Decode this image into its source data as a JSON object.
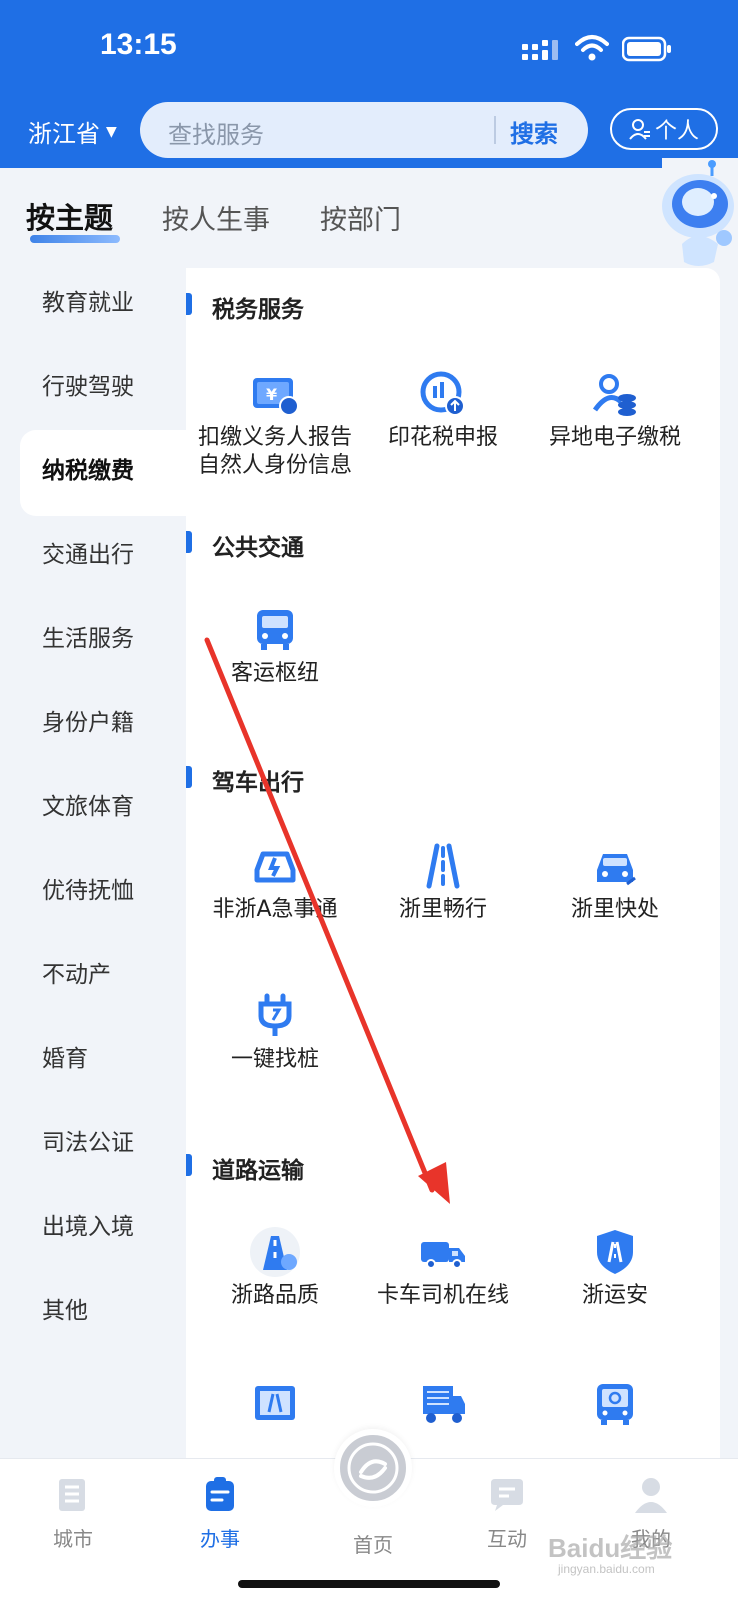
{
  "status": {
    "time": "13:15"
  },
  "header": {
    "province": "浙江省",
    "search_placeholder": "查找服务",
    "search_button": "搜索",
    "person_button": "个人"
  },
  "top_tabs": [
    "按主题",
    "按人生事",
    "按部门"
  ],
  "sidebar": {
    "items": [
      "教育就业",
      "行驶驾驶",
      "纳税缴费",
      "交通出行",
      "生活服务",
      "身份户籍",
      "文旅体育",
      "优待抚恤",
      "不动产",
      "婚育",
      "司法公证",
      "出境入境",
      "其他"
    ],
    "active": "纳税缴费"
  },
  "sections": [
    {
      "title": "税务服务",
      "services": [
        {
          "label_lines": [
            "扣缴义务人报告",
            "自然人身份信息"
          ],
          "icon": "tax-ticket-icon"
        },
        {
          "label_lines": [
            "印花税申报"
          ],
          "icon": "stamp-tax-icon"
        },
        {
          "label_lines": [
            "异地电子缴税"
          ],
          "icon": "remote-tax-icon"
        }
      ]
    },
    {
      "title": "公共交通",
      "services": [
        {
          "label_lines": [
            "客运枢纽"
          ],
          "icon": "bus-icon"
        }
      ]
    },
    {
      "title": "驾车出行",
      "services": [
        {
          "label_lines": [
            "非浙A急事通"
          ],
          "icon": "car-alert-icon"
        },
        {
          "label_lines": [
            "浙里畅行"
          ],
          "icon": "road-icon"
        },
        {
          "label_lines": [
            "浙里快处"
          ],
          "icon": "car-accident-icon"
        },
        {
          "label_lines": [
            "一键找桩"
          ],
          "icon": "charger-icon"
        }
      ]
    },
    {
      "title": "道路运输",
      "services": [
        {
          "label_lines": [
            "浙路品质"
          ],
          "icon": "road-quality-icon"
        },
        {
          "label_lines": [
            "卡车司机在线"
          ],
          "icon": "truck-icon"
        },
        {
          "label_lines": [
            "浙运安"
          ],
          "icon": "shield-road-icon"
        }
      ]
    }
  ],
  "bottom_nav": [
    {
      "label": "城市",
      "icon": "city-icon"
    },
    {
      "label": "办事",
      "icon": "task-icon",
      "active": true
    },
    {
      "label": "首页",
      "icon": "home-logo-icon"
    },
    {
      "label": "互动",
      "icon": "chat-icon"
    },
    {
      "label": "我的",
      "icon": "profile-icon"
    }
  ],
  "watermark": {
    "brand": "Baidu经验",
    "sub": "jingyan.baidu.com"
  },
  "colors": {
    "primary": "#1f6fe5",
    "arrow": "#e8342a"
  }
}
